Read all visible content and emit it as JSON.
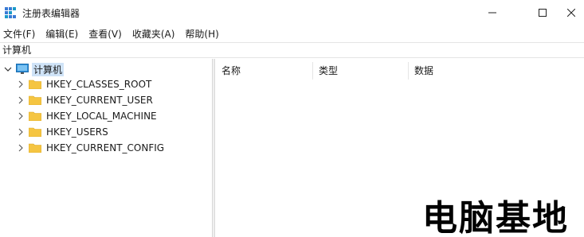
{
  "window": {
    "title": "注册表编辑器",
    "minimize_glyph": "—",
    "maximize_glyph": "☐",
    "close_glyph": "✕"
  },
  "menu": [
    "文件(F)",
    "编辑(E)",
    "查看(V)",
    "收藏夹(A)",
    "帮助(H)"
  ],
  "address": "计算机",
  "tree": {
    "root": "计算机",
    "items": [
      "HKEY_CLASSES_ROOT",
      "HKEY_CURRENT_USER",
      "HKEY_LOCAL_MACHINE",
      "HKEY_USERS",
      "HKEY_CURRENT_CONFIG"
    ]
  },
  "list": {
    "columns": [
      "名称",
      "类型",
      "数据"
    ]
  },
  "watermark": "电脑基地",
  "colors": {
    "folder": "#f5c542",
    "selection": "#cfe3f7",
    "pc": "#2f8fd8"
  }
}
